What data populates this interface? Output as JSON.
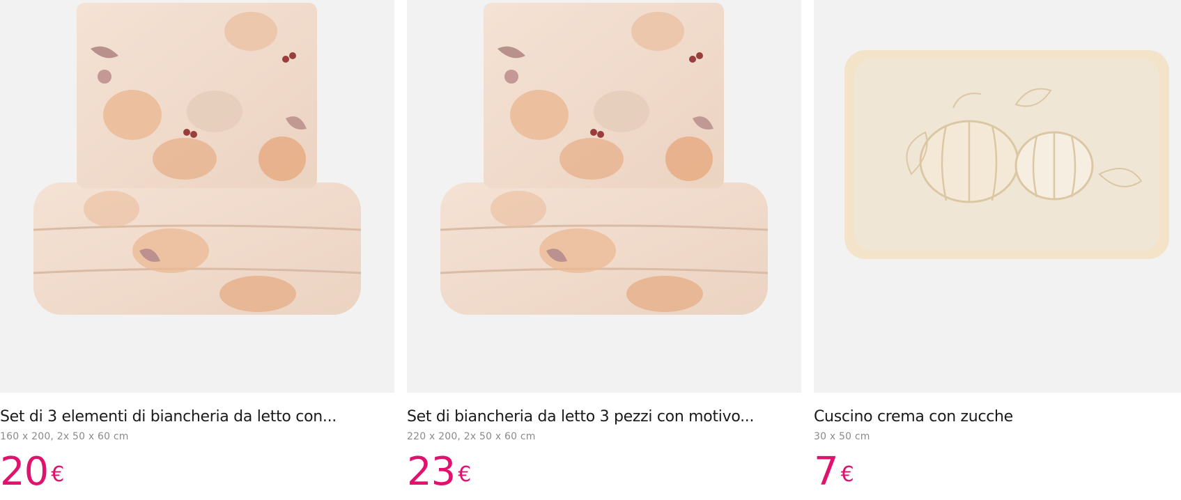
{
  "products": [
    {
      "title": "Set di 3 elementi di biancheria da letto con...",
      "dimensions": "160 x 200, 2x 50 x 60 cm",
      "price": "20",
      "currency": "€",
      "image": "pumpkin-bedding-set-image"
    },
    {
      "title": "Set di biancheria da letto 3 pezzi con motivo...",
      "dimensions": "220 x 200, 2x 50 x 60 cm",
      "price": "23",
      "currency": "€",
      "image": "pumpkin-bedding-set-image"
    },
    {
      "title": "Cuscino crema con zucche",
      "dimensions": "30 x 50 cm",
      "price": "7",
      "currency": "€",
      "image": "cream-pumpkin-cushion-image"
    }
  ],
  "colors": {
    "price": "#e0126e",
    "image_bg": "#f2f2f2",
    "fabric": "#f1dccd",
    "pumpkin": "#e8b48a",
    "cushion": "#efe6d6"
  }
}
